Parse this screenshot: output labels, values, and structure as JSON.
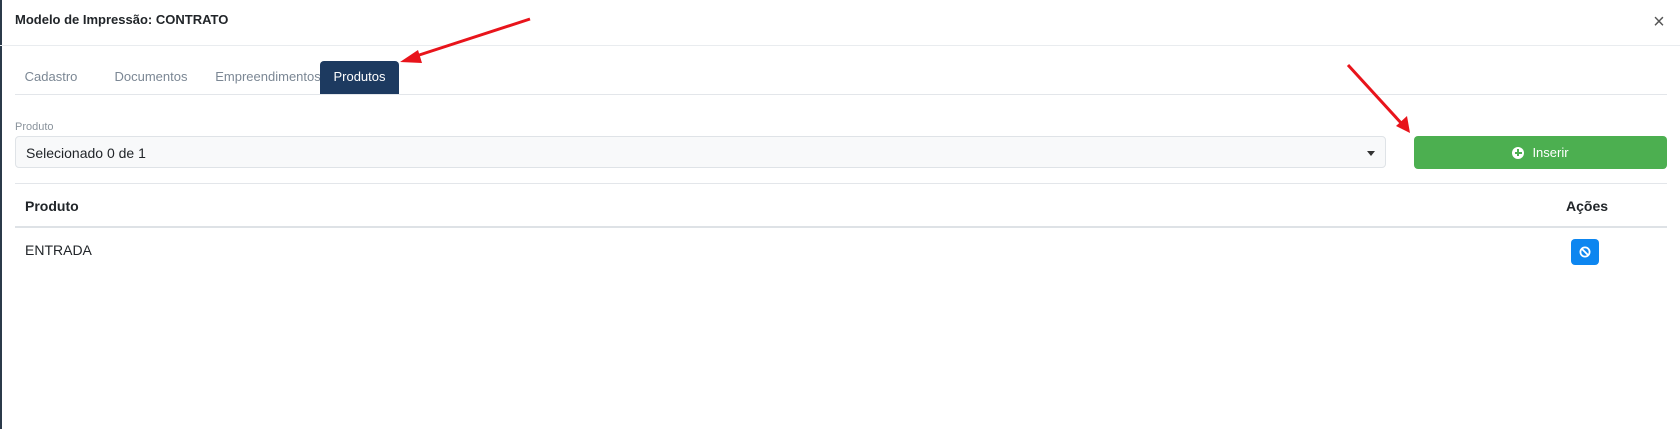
{
  "modal": {
    "title": "Modelo de Impressão: CONTRATO",
    "close_label": "×"
  },
  "tabs": [
    {
      "label": "Cadastro",
      "active": false
    },
    {
      "label": "Documentos",
      "active": false
    },
    {
      "label": "Empreendimentos",
      "active": false
    },
    {
      "label": "Produtos",
      "active": true
    }
  ],
  "form": {
    "field_label": "Produto",
    "select_value": "Selecionado 0 de 1",
    "insert_button_label": "Inserir"
  },
  "table": {
    "headers": {
      "product": "Produto",
      "actions": "Ações"
    },
    "rows": [
      {
        "product": "ENTRADA",
        "action_icon": "ban-icon"
      }
    ]
  },
  "colors": {
    "active_tab": "#1d3a60",
    "insert_button": "#4caf50",
    "action_button": "#0d86f0",
    "annotation_arrow": "#e8141b"
  },
  "icons": {
    "close": "close-icon",
    "insert": "plus-circle-icon",
    "select_caret": "caret-down-icon",
    "row_action": "ban-icon"
  }
}
